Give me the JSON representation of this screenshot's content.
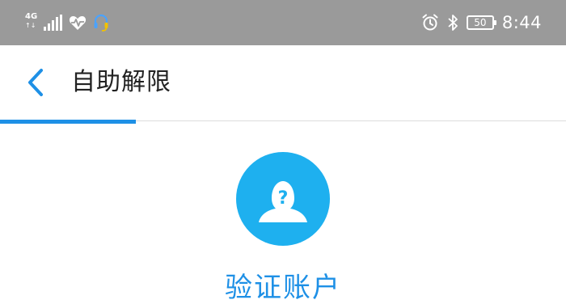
{
  "status_bar": {
    "network_type": "4G",
    "network_arrows": "↑↓",
    "battery_level": "50",
    "time": "8:44",
    "icons": [
      "signal-icon",
      "heart-rate-icon",
      "headset-icon",
      "alarm-icon",
      "bluetooth-icon",
      "battery-icon"
    ]
  },
  "header": {
    "title": "自助解限",
    "back_icon": "chevron-left-icon"
  },
  "progress": {
    "fraction": 0.24,
    "color": "#1e90e6"
  },
  "main": {
    "avatar_icon": "unknown-user-icon",
    "step_title": "验证账户"
  },
  "colors": {
    "status_bar": "#9a9a9a",
    "accent": "#1e90e6",
    "avatar_bg": "#1eb0ef"
  }
}
